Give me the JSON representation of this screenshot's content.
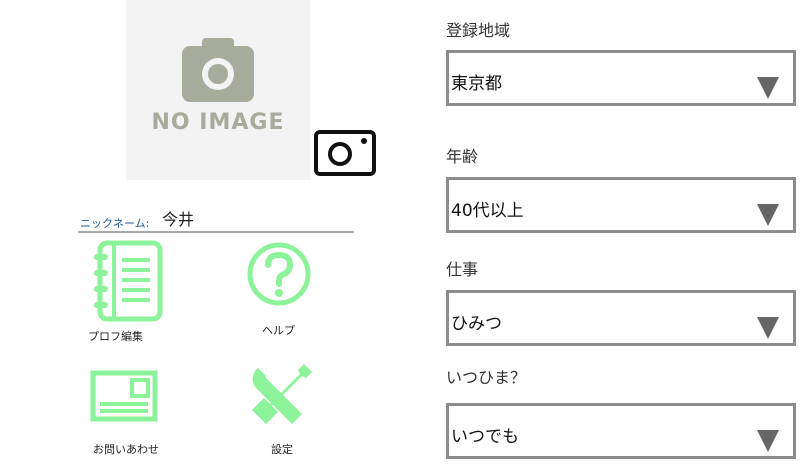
{
  "profile": {
    "no_image_text": "NO IMAGE",
    "camera_icon": "camera-icon",
    "nickname_label": "ニックネーム:",
    "nickname_value": "今井"
  },
  "menu": [
    {
      "label": "プロフ編集",
      "icon": "notebook-icon"
    },
    {
      "label": "ヘルプ",
      "icon": "question-icon"
    },
    {
      "label": "お問いあわせ",
      "icon": "contact-card-icon"
    },
    {
      "label": "設定",
      "icon": "tools-icon"
    }
  ],
  "fields": [
    {
      "label": "登録地域",
      "value": "東京都"
    },
    {
      "label": "年齢",
      "value": "40代以上"
    },
    {
      "label": "仕事",
      "value": "ひみつ"
    },
    {
      "label": "いつひま？",
      "value": "いつでも"
    }
  ],
  "colors": {
    "icon_green": "#8df39a",
    "nickname_label": "#1f5a9c",
    "select_border": "#8c8c8c"
  }
}
